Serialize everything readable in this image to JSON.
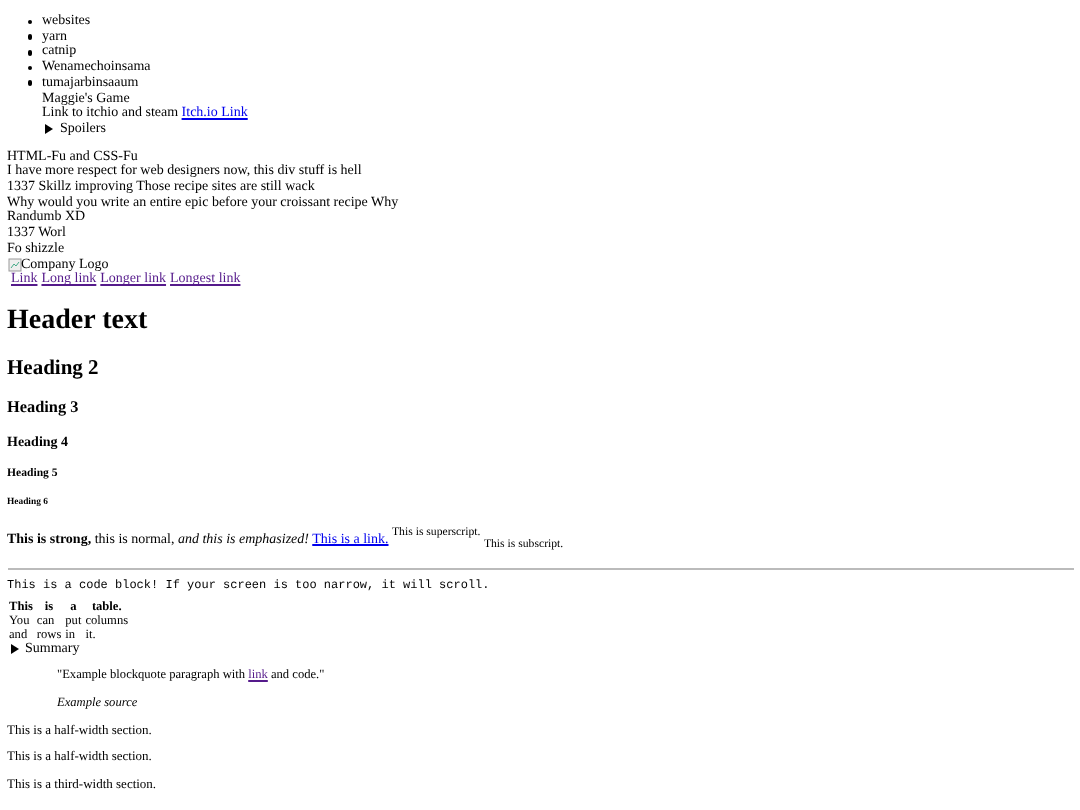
{
  "list": [
    "websites",
    "yarn",
    "catnip",
    "Wenamechoinsama",
    "tumajarbinsaaum"
  ],
  "game": {
    "title": "Maggie's Game",
    "link_intro": "Link to itchio and steam",
    "link": {
      "label": "Itch.io Link",
      "visited": false
    },
    "spoilers": {
      "summary": "Spoilers",
      "expanded": false
    }
  },
  "lines": [
    "HTML-Fu and CSS-Fu",
    "I have more respect for web designers now, this div stuff is hell",
    "1337 Skillz improving Those recipe sites are still wack",
    "Why would you write an entire epic before your croissant recipe Why",
    "Randumb XD",
    "1337 Worl",
    "Fo shizzle"
  ],
  "logo": {
    "alt": "Company Logo"
  },
  "nav_links": [
    {
      "label": "Link",
      "visited": true
    },
    {
      "label": "Long link",
      "visited": true
    },
    {
      "label": "Longer link",
      "visited": true
    },
    {
      "label": "Longest link",
      "visited": true
    }
  ],
  "headings": [
    {
      "kind": "h1",
      "text": "Header text"
    },
    {
      "kind": "h2",
      "text": "Heading 2"
    },
    {
      "kind": "h3",
      "text": "Heading 3"
    },
    {
      "kind": "h4",
      "text": "Heading 4"
    },
    {
      "kind": "h5",
      "text": "Heading 5"
    },
    {
      "kind": "h6",
      "text": "Heading 6"
    }
  ],
  "formatting": {
    "before": "**This is strong,** this is normal, *and this is emphasized!*",
    "link": {
      "label": "This is a link.",
      "visited": false
    },
    "after": "$^{This is superscript.}$ $_{This is subscript.}$"
  },
  "code_block": "This is a code block! If your screen is too narrow, it will scroll.",
  "table": {
    "header": [
      "This",
      "is",
      "a",
      "table."
    ],
    "rows": [
      [
        "You",
        "can",
        "put",
        "columns"
      ],
      [
        "and",
        "rows",
        "in",
        "it."
      ]
    ]
  },
  "summary": {
    "label": "Summary",
    "expanded": false
  },
  "blockquote": {
    "before": "\"Example blockquote paragraph with",
    "link": {
      "label": "link",
      "visited": true
    },
    "after": "and code.\"",
    "source": "Example source"
  },
  "sections": [
    "This is a half-width section.",
    "This is a half-width section.",
    "This is a third-width section."
  ]
}
